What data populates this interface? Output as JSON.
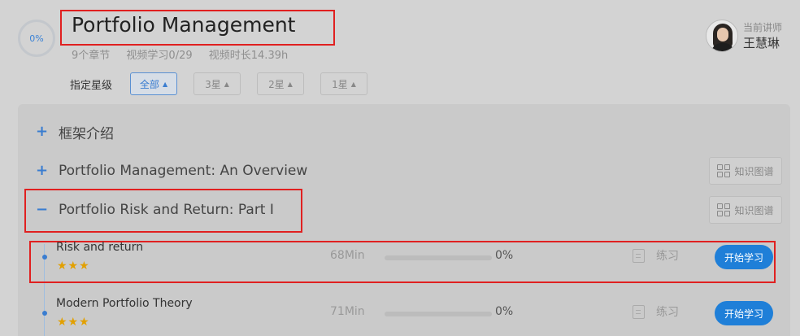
{
  "course": {
    "progress_label": "0%",
    "title": "Portfolio Management",
    "meta": {
      "chapters": "9个章节",
      "videos": "视频学习0/29",
      "duration": "视频时长14.39h"
    }
  },
  "teacher": {
    "label": "当前讲师",
    "name": "王慧琳"
  },
  "filter": {
    "label": "指定星级",
    "options": [
      {
        "label": "全部",
        "active": true
      },
      {
        "label": "3星",
        "active": false
      },
      {
        "label": "2星",
        "active": false
      },
      {
        "label": "1星",
        "active": false
      }
    ],
    "caret": "▲"
  },
  "chapters": [
    {
      "toggle": "+",
      "title": "框架介绍",
      "kg_label": ""
    },
    {
      "toggle": "+",
      "title": "Portfolio Management: An Overview",
      "kg_label": "知识图谱"
    },
    {
      "toggle": "−",
      "title": "Portfolio Risk and Return: Part I",
      "kg_label": "知识图谱"
    }
  ],
  "lessons": [
    {
      "title": "Risk and return",
      "stars": "★★★",
      "duration": "68Min",
      "progress": 0,
      "progress_label": "0%",
      "practice": "练习",
      "start": "开始学习"
    },
    {
      "title": "Modern Portfolio Theory",
      "stars": "★★★",
      "duration": "71Min",
      "progress": 0,
      "progress_label": "0%",
      "practice": "练习",
      "start": "开始学习"
    }
  ],
  "colors": {
    "accent": "#1f7fd8",
    "highlight_box": "#e02020",
    "star": "#e2a000"
  }
}
